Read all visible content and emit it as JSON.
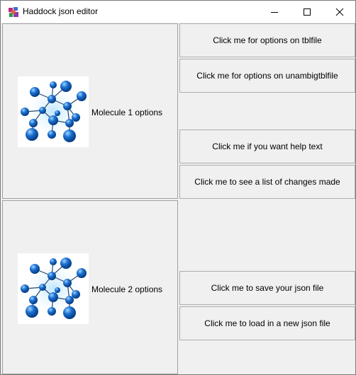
{
  "window": {
    "title": "Haddock json editor",
    "app_icon": "haddock-app-icon",
    "controls": {
      "minimize_icon": "minimize-icon",
      "maximize_icon": "maximize-icon",
      "close_icon": "close-icon"
    }
  },
  "molecules": [
    {
      "label": "Molecule 1 options",
      "icon": "molecule-icon"
    },
    {
      "label": "Molecule 2 options",
      "icon": "molecule-icon"
    }
  ],
  "buttons": {
    "tblfile": "Click me for options on tblfile",
    "unambigtblfile": "Click me for options on unambigtblfile",
    "help": "Click me if you want help text",
    "changes": "Click me to see a list of changes made",
    "save": "Click me to save your json file",
    "load": "Click me to load in a new json file"
  },
  "colors": {
    "background": "#f0f0f0",
    "titlebar": "#ffffff",
    "molecule_blue": "#1a6fd0"
  }
}
